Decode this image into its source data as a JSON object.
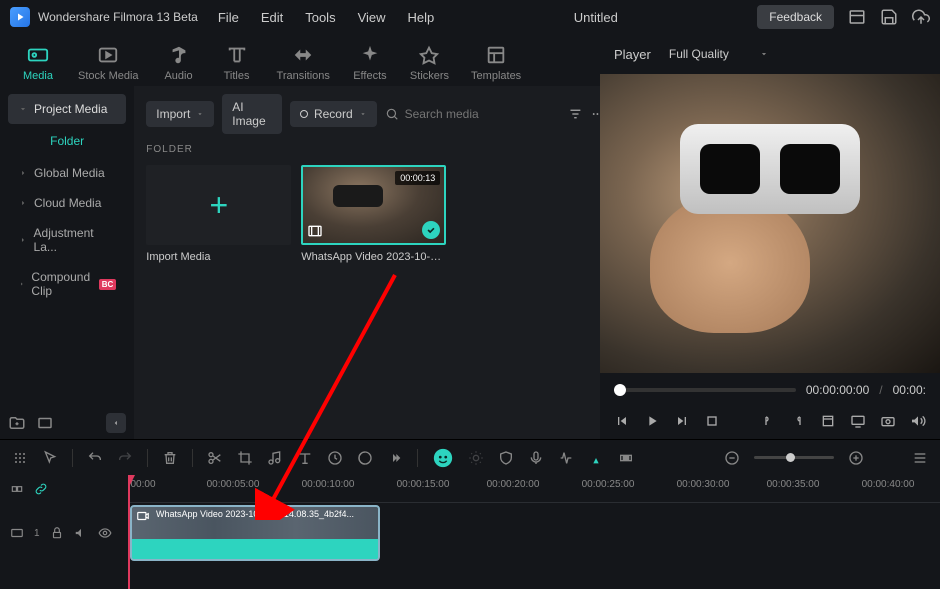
{
  "titlebar": {
    "app_name": "Wondershare Filmora 13 Beta",
    "menus": [
      "File",
      "Edit",
      "Tools",
      "View",
      "Help"
    ],
    "document": "Untitled",
    "feedback": "Feedback"
  },
  "tabs": [
    {
      "label": "Media",
      "active": true
    },
    {
      "label": "Stock Media",
      "active": false
    },
    {
      "label": "Audio",
      "active": false
    },
    {
      "label": "Titles",
      "active": false
    },
    {
      "label": "Transitions",
      "active": false
    },
    {
      "label": "Effects",
      "active": false
    },
    {
      "label": "Stickers",
      "active": false
    },
    {
      "label": "Templates",
      "active": false
    }
  ],
  "sidebar": {
    "items": [
      {
        "label": "Project Media",
        "selected": true,
        "expandable": true
      },
      {
        "label": "Folder",
        "folder": true
      },
      {
        "label": "Global Media",
        "expandable": true
      },
      {
        "label": "Cloud Media",
        "expandable": true
      },
      {
        "label": "Adjustment La...",
        "expandable": true
      },
      {
        "label": "Compound Clip",
        "expandable": true,
        "badge": "BC"
      }
    ]
  },
  "media_toolbar": {
    "import": "Import",
    "ai_image": "AI Image",
    "record": "Record",
    "search_placeholder": "Search media"
  },
  "folder_label": "FOLDER",
  "media_tiles": {
    "import_label": "Import Media",
    "video": {
      "duration": "00:00:13",
      "name": "WhatsApp Video 2023-10-05..."
    }
  },
  "player": {
    "label": "Player",
    "quality": "Full Quality",
    "current_time": "00:00:00:00",
    "total_time": "00:00:"
  },
  "timeline": {
    "ruler": [
      "00:00",
      "00:00:05:00",
      "00:00:10:00",
      "00:00:15:00",
      "00:00:20:00",
      "00:00:25:00",
      "00:00:30:00",
      "00:00:35:00",
      "00:00:40:00"
    ],
    "track_number": "1",
    "clip_label": "WhatsApp Video 2023-10-05 at 14.08.35_4b2f4..."
  }
}
